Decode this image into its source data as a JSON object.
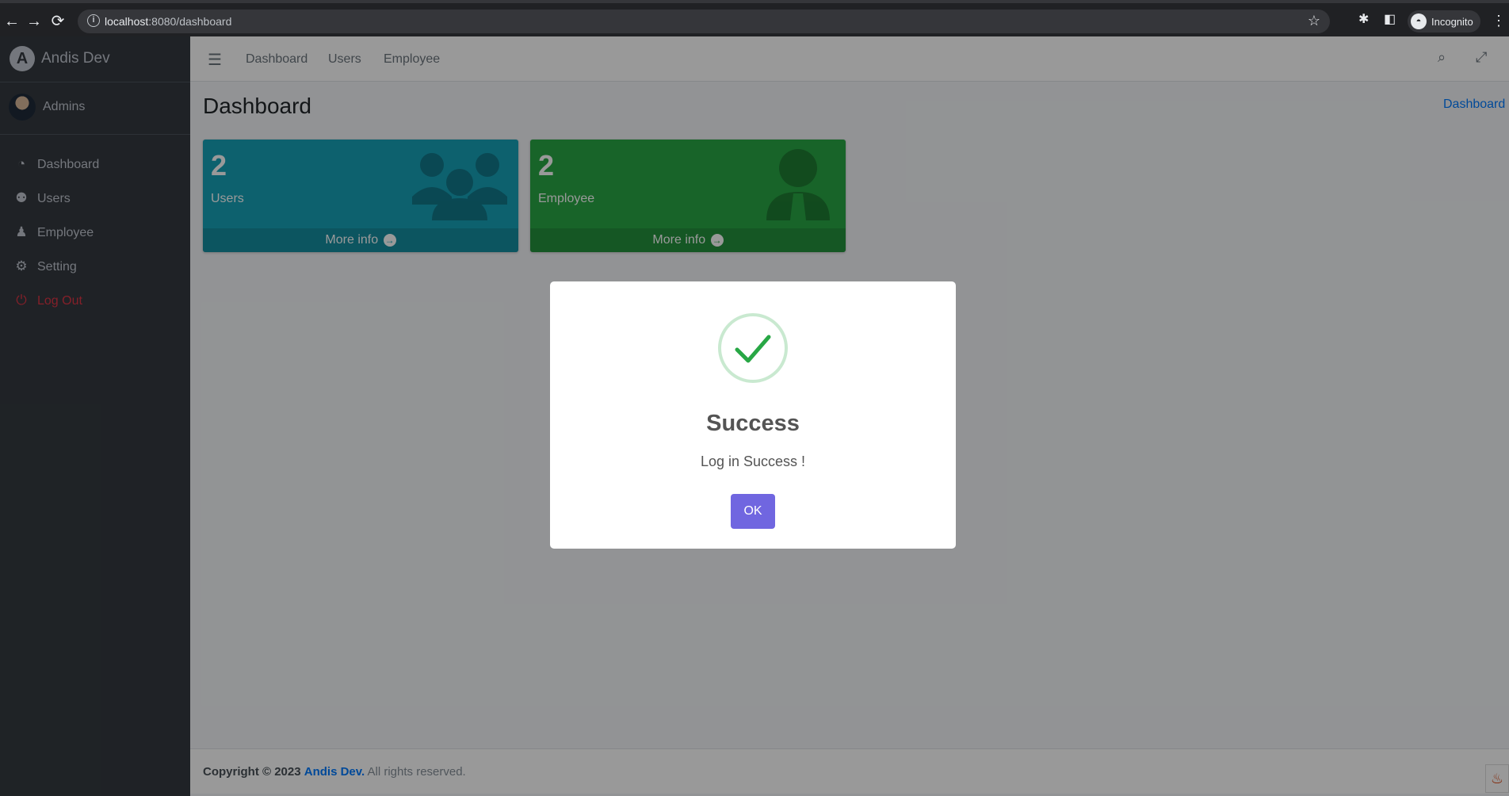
{
  "browser": {
    "url_host": "localhost",
    "url_path": ":8080/dashboard",
    "incognito_label": "Incognito"
  },
  "sidebar": {
    "brand": "Andis Dev",
    "brand_logo_letter": "A",
    "user_name": "Admins",
    "items": [
      {
        "label": "Dashboard",
        "icon": "tachometer-icon"
      },
      {
        "label": "Users",
        "icon": "users-icon"
      },
      {
        "label": "Employee",
        "icon": "user-tie-icon"
      },
      {
        "label": "Setting",
        "icon": "gear-icon"
      },
      {
        "label": "Log Out",
        "icon": "power-icon",
        "color": "#dc3545"
      }
    ]
  },
  "topnav": {
    "links": [
      "Dashboard",
      "Users",
      "Employee"
    ]
  },
  "header": {
    "title": "Dashboard",
    "breadcrumb": "Dashboard"
  },
  "stats": [
    {
      "value": "2",
      "label": "Users",
      "more": "More info",
      "color": "#17a2b8"
    },
    {
      "value": "2",
      "label": "Employee",
      "more": "More info",
      "color": "#28a745"
    }
  ],
  "footer": {
    "copyright_prefix": "Copyright © 2023",
    "company": "Andis Dev.",
    "suffix": "All rights reserved."
  },
  "modal": {
    "title": "Success",
    "text": "Log in Success !",
    "ok_label": "OK",
    "accent": "#7066e0",
    "success_color": "#28a745"
  }
}
